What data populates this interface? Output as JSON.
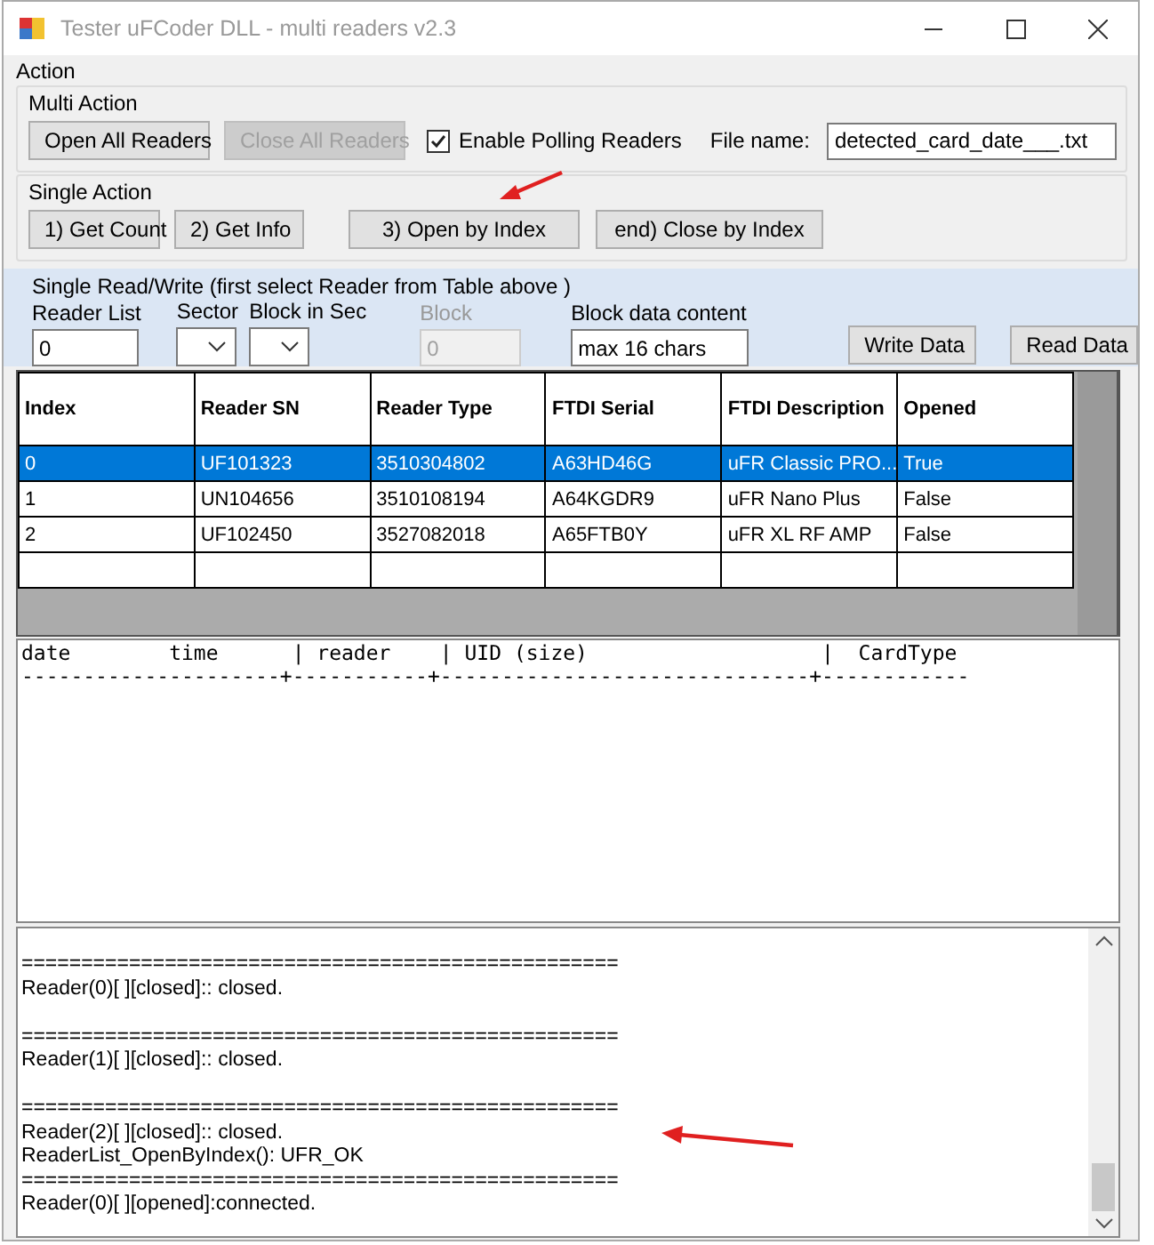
{
  "window": {
    "title": "Tester uFCoder DLL - multi readers v2.3"
  },
  "action": {
    "label": "Action",
    "multi_action": {
      "label": "Multi Action",
      "buttons": [
        {
          "label": "Open All Readers",
          "disabled": false
        },
        {
          "label": "Close All Readers",
          "disabled": true
        }
      ],
      "polling": {
        "label": "Enable Polling Readers",
        "checked": true
      },
      "file_name": {
        "label": "File name:",
        "value": "detected_card_date___.txt"
      }
    },
    "single_action": {
      "label": "Single Action",
      "buttons": [
        {
          "label": "1) Get Count",
          "disabled": false
        },
        {
          "label": "2) Get Info",
          "disabled": false
        },
        {
          "label": "3) Open by Index",
          "disabled": false
        },
        {
          "label": "end) Close by Index",
          "disabled": false
        }
      ]
    }
  },
  "read_write": {
    "label": "Single Read/Write  (first select Reader from Table above )",
    "reader_list": {
      "label": "Reader List",
      "value": "0"
    },
    "sector": {
      "label": "Sector"
    },
    "block_in_sec": {
      "label": "Block in Sec"
    },
    "block": {
      "label": "Block",
      "value": "0",
      "disabled": true
    },
    "block_data": {
      "label": "Block data content",
      "value": "max 16 chars"
    },
    "buttons": [
      {
        "label": "Write Data",
        "disabled": false
      },
      {
        "label": "Read Data",
        "disabled": false
      }
    ]
  },
  "table": {
    "columns": [
      "Index",
      "Reader SN",
      "Reader Type",
      "FTDI Serial",
      "FTDI Description",
      "Opened"
    ],
    "rows": [
      {
        "cells": [
          "0",
          "UF101323",
          "3510304802",
          "A63HD46G",
          "uFR Classic PRO...",
          "True"
        ],
        "selected": true
      },
      {
        "cells": [
          "1",
          "UN104656",
          "3510108194",
          "A64KGDR9",
          "uFR Nano Plus",
          "False"
        ],
        "selected": false
      },
      {
        "cells": [
          "2",
          "UF102450",
          "3527082018",
          "A65FTB0Y",
          "uFR XL RF AMP",
          "False"
        ],
        "selected": false
      }
    ]
  },
  "card_log": {
    "header": "date        time      | reader    | UID (size)                   |  CardType",
    "rule": "---------------------+-----------+------------------------------+------------"
  },
  "event_log": {
    "entries": [
      {
        "separator": "==================================================",
        "lines": [
          "Reader(0)[ ][closed]:: closed."
        ],
        "spaced": true
      },
      {
        "separator": "==================================================",
        "lines": [
          "Reader(1)[ ][closed]:: closed."
        ],
        "spaced": true
      },
      {
        "separator": "==================================================",
        "lines": [
          "Reader(2)[ ][closed]:: closed.",
          "ReaderList_OpenByIndex(): UFR_OK"
        ],
        "spaced": false
      },
      {
        "separator": "==================================================",
        "lines": [
          "Reader(0)[ ][opened]:connected."
        ],
        "spaced": false
      }
    ]
  }
}
